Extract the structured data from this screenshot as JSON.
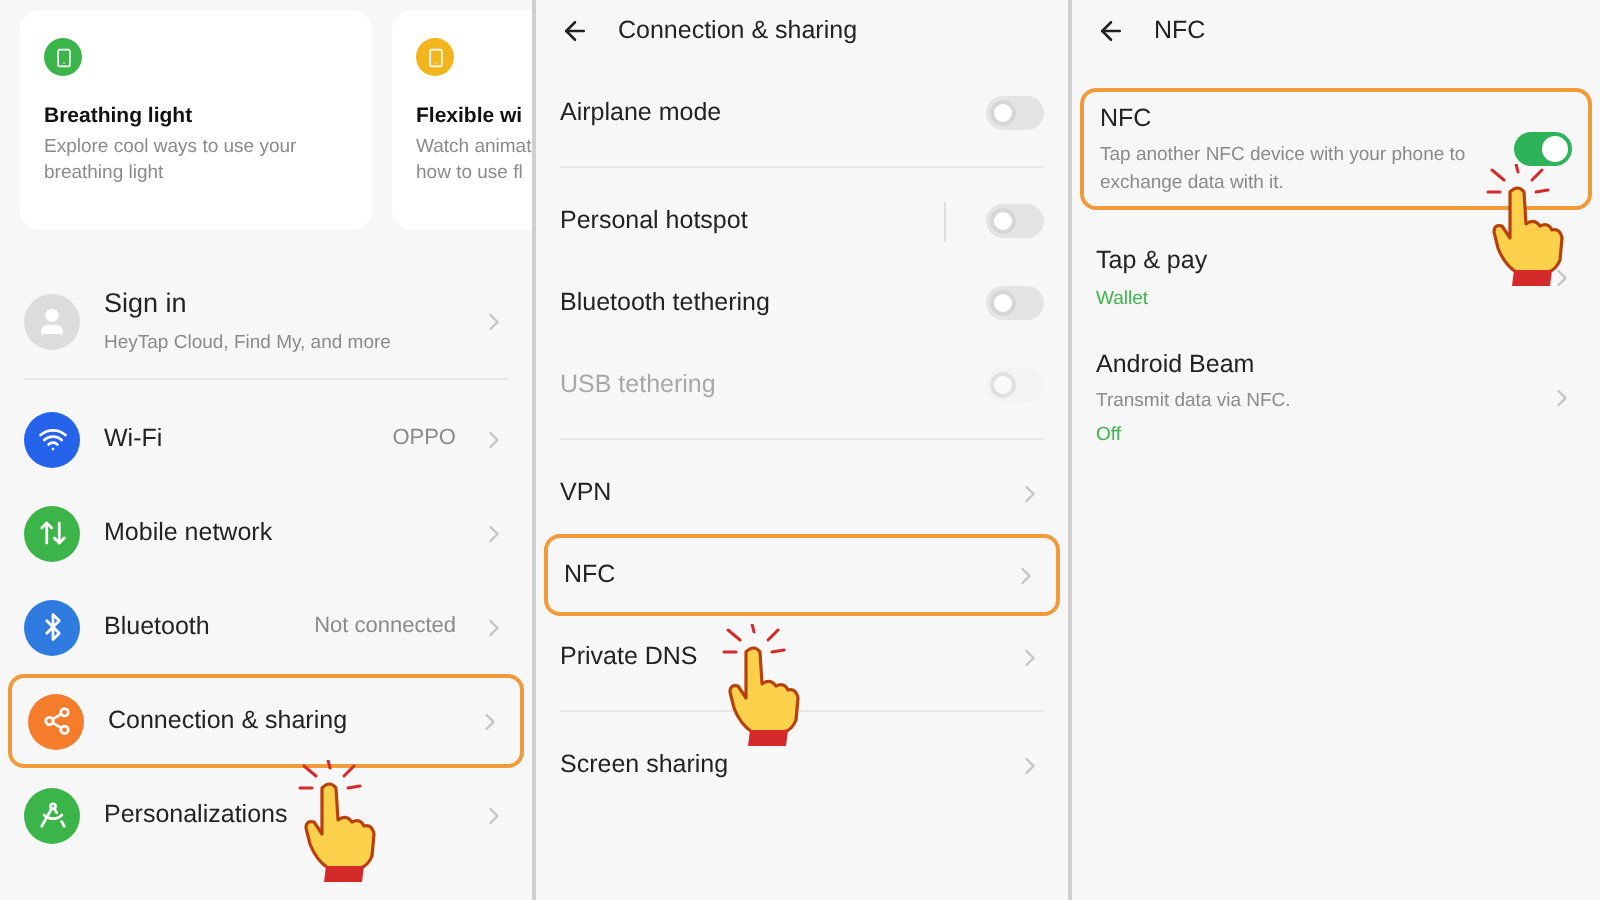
{
  "panels": [
    {
      "kind": "home",
      "cards": [
        {
          "title": "Breathing light",
          "lines": [
            "Explore cool ways to use your",
            "breathing light"
          ],
          "color": "#3bb54a"
        },
        {
          "title": "Flexible wi",
          "lines": [
            "Watch animat",
            "how to use fl"
          ],
          "color": "#f2b51d"
        }
      ],
      "sections": [
        {
          "rows": [
            {
              "kind": "account",
              "label": "Sign in",
              "subtitle": "HeyTap Cloud, Find My, and more",
              "highlighted": false
            }
          ]
        },
        {
          "rows": [
            {
              "kind": "link",
              "label": "Wi-Fi",
              "value": "OPPO",
              "color": "#2563eb",
              "highlighted": false
            },
            {
              "kind": "link",
              "label": "Mobile network",
              "color": "#3bb54a",
              "highlighted": false
            },
            {
              "kind": "link",
              "label": "Bluetooth",
              "value": "Not connected",
              "color": "#2f7be0",
              "highlighted": false
            },
            {
              "kind": "link",
              "label": "Connection & sharing",
              "color": "#f57c2b",
              "highlighted": true
            },
            {
              "kind": "link",
              "label": "Personalizations",
              "color": "#3bb54a",
              "highlighted": false
            }
          ]
        }
      ]
    },
    {
      "kind": "list",
      "title": "Connection & sharing",
      "sections": [
        {
          "rows": [
            {
              "kind": "toggle",
              "label": "Airplane mode",
              "on": false,
              "disabled": false,
              "highlighted": false
            }
          ]
        },
        {
          "rows": [
            {
              "kind": "toggle",
              "label": "Personal hotspot",
              "on": false,
              "disabled": false,
              "separator": true,
              "highlighted": false
            },
            {
              "kind": "toggle",
              "label": "Bluetooth tethering",
              "on": false,
              "disabled": false,
              "highlighted": false
            },
            {
              "kind": "toggle",
              "label": "USB tethering",
              "on": false,
              "disabled": true,
              "highlighted": false
            }
          ]
        },
        {
          "rows": [
            {
              "kind": "link",
              "label": "VPN",
              "highlighted": false
            },
            {
              "kind": "link",
              "label": "NFC",
              "highlighted": true
            },
            {
              "kind": "link",
              "label": "Private DNS",
              "highlighted": false
            }
          ]
        },
        {
          "rows": [
            {
              "kind": "link",
              "label": "Screen sharing",
              "highlighted": false
            }
          ]
        }
      ]
    },
    {
      "kind": "list",
      "title": "NFC",
      "sections": [
        {
          "rows": [
            {
              "kind": "toggle",
              "label": "NFC",
              "subtitle": "Tap another NFC device with your phone to exchange data with it.",
              "on": true,
              "disabled": false,
              "highlighted": true
            },
            {
              "kind": "link",
              "label": "Tap & pay",
              "status": "Wallet",
              "highlighted": false
            },
            {
              "kind": "link",
              "label": "Android Beam",
              "subtitle": "Transmit data via NFC.",
              "status": "Off",
              "highlighted": false
            }
          ]
        }
      ]
    }
  ]
}
